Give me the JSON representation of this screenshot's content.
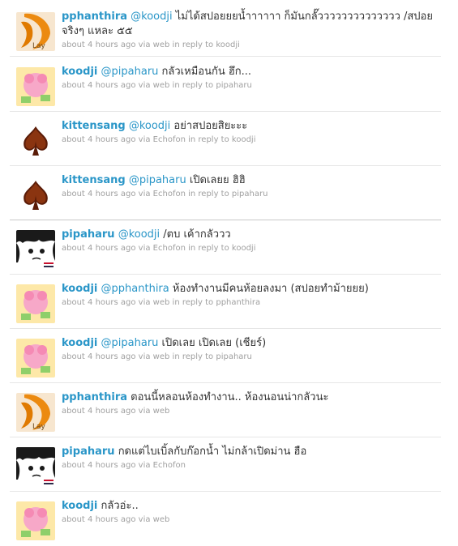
{
  "tweets": [
    {
      "user": "pphanthira",
      "mention": "@koodji",
      "text": "ไม่ได้สปอยยยน้ำาาาาา ก็มันกลั๊วววววววววววววว /สปอยจริงๆ แหละ ๕๕",
      "time": "about 4 hours ago",
      "via_text": "via",
      "via": "web",
      "reply_text": "in reply to",
      "reply": "koodji",
      "avatar": "orange"
    },
    {
      "user": "koodji",
      "mention": "@pipaharu",
      "text": "กลัวเหมือนกัน ฮึก...",
      "time": "about 4 hours ago",
      "via_text": "via",
      "via": "web",
      "reply_text": "in reply to",
      "reply": "pipaharu",
      "avatar": "pink"
    },
    {
      "user": "kittensang",
      "mention": "@koodji",
      "text": "อย่าสปอยสิยะะะ",
      "time": "about 4 hours ago",
      "via_text": "via",
      "via": "Echofon",
      "reply_text": "in reply to",
      "reply": "koodji",
      "avatar": "spade"
    },
    {
      "user": "kittensang",
      "mention": "@pipaharu",
      "text": "เปิดเลยย ฮิฮิ",
      "time": "about 4 hours ago",
      "via_text": "via",
      "via": "Echofon",
      "reply_text": "in reply to",
      "reply": "pipaharu",
      "avatar": "spade"
    },
    {
      "user": "pipaharu",
      "mention": "@koodji",
      "text": "/ตบ เค้ากลัววว",
      "time": "about 4 hours ago",
      "via_text": "via",
      "via": "Echofon",
      "reply_text": "in reply to",
      "reply": "koodji",
      "avatar": "manga"
    },
    {
      "user": "koodji",
      "mention": "@pphanthira",
      "text": "ห้องทำงานมีคนห้อยลงมา (สปอยทำม้ายยย)",
      "time": "about 4 hours ago",
      "via_text": "via",
      "via": "web",
      "reply_text": "in reply to",
      "reply": "pphanthira",
      "avatar": "pink"
    },
    {
      "user": "koodji",
      "mention": "@pipaharu",
      "text": "เปิดเลย เปิดเลย (เชียร์)",
      "time": "about 4 hours ago",
      "via_text": "via",
      "via": "web",
      "reply_text": "in reply to",
      "reply": "pipaharu",
      "avatar": "pink"
    },
    {
      "user": "pphanthira",
      "mention": "",
      "text": "ตอนนี้หลอนห้องทำงาน.. ห้องนอนน่ากลัวนะ",
      "time": "about 4 hours ago",
      "via_text": "via",
      "via": "web",
      "reply_text": "",
      "reply": "",
      "avatar": "orange"
    },
    {
      "user": "pipaharu",
      "mention": "",
      "text": "กดแต่ไบเบิ้ลกับก๊อกน้ำ ไม่กล้าเปิดม่าน ฮือ",
      "time": "about 4 hours ago",
      "via_text": "via",
      "via": "Echofon",
      "reply_text": "",
      "reply": "",
      "avatar": "manga"
    },
    {
      "user": "koodji",
      "mention": "",
      "text": "กลัวอ่ะ..",
      "time": "about 4 hours ago",
      "via_text": "via",
      "via": "web",
      "reply_text": "",
      "reply": "",
      "avatar": "pink"
    }
  ],
  "colors": {
    "link": "#2a96c8",
    "text": "#333333",
    "meta": "#a0a0a0",
    "divider": "#e6e6e6"
  }
}
